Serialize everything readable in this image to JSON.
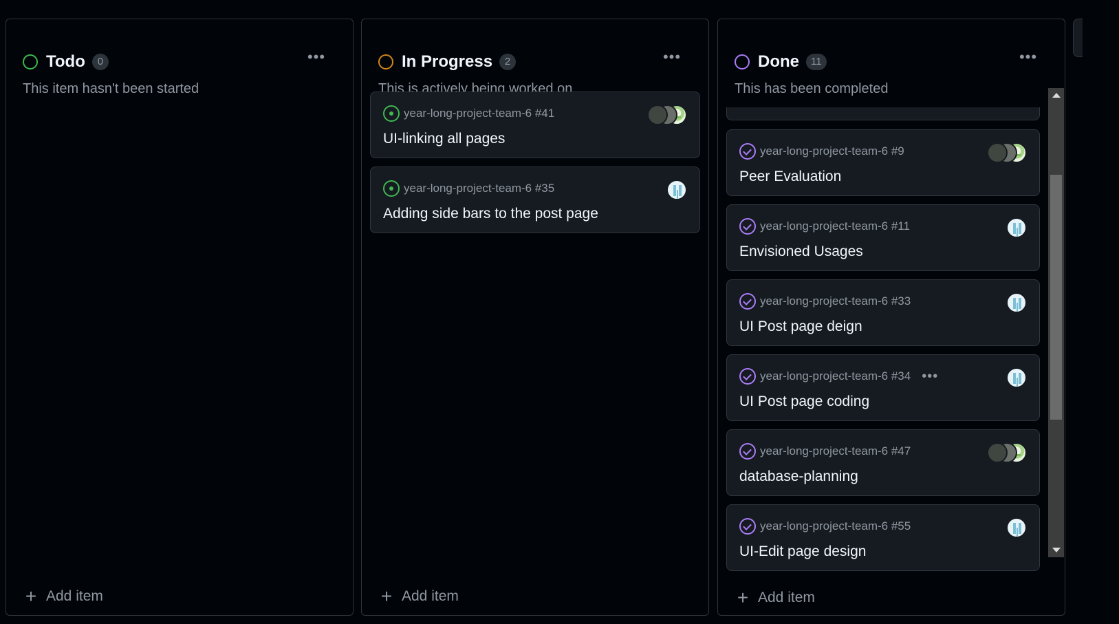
{
  "columns": [
    {
      "title": "Todo",
      "count": "0",
      "description": "This item hasn't been started",
      "status_color": "#3fb950",
      "add_label": "Add item",
      "cards": []
    },
    {
      "title": "In Progress",
      "count": "2",
      "description": "This is actively being worked on",
      "status_color": "#d18616",
      "add_label": "Add item",
      "cards": [
        {
          "repo": "year-long-project-team-6 #41",
          "title": "UI-linking all pages",
          "state": "open"
        },
        {
          "repo": "year-long-project-team-6 #35",
          "title": "Adding side bars to the post page",
          "state": "open"
        }
      ]
    },
    {
      "title": "Done",
      "count": "11",
      "description": "This has been completed",
      "status_color": "#ab7df8",
      "add_label": "Add item",
      "cards": [
        {
          "repo": "year-long-project-team-6 #9",
          "title": "Peer Evaluation",
          "state": "closed"
        },
        {
          "repo": "year-long-project-team-6 #11",
          "title": "Envisioned Usages",
          "state": "closed"
        },
        {
          "repo": "year-long-project-team-6 #33",
          "title": "UI Post page deign",
          "state": "closed"
        },
        {
          "repo": "year-long-project-team-6 #34",
          "title": "UI Post page coding",
          "state": "closed",
          "menu": "•••"
        },
        {
          "repo": "year-long-project-team-6 #47",
          "title": "database-planning",
          "state": "closed"
        },
        {
          "repo": "year-long-project-team-6 #55",
          "title": "UI-Edit page design",
          "state": "closed"
        }
      ]
    }
  ],
  "column_menu_glyph": "•••",
  "add_glyph": "+",
  "icons": [
    "status-ring-icon",
    "issue-open-icon",
    "issue-closed-icon",
    "kebab-menu-icon",
    "plus-icon",
    "avatar"
  ]
}
